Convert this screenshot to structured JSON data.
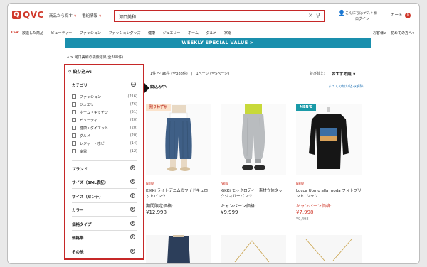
{
  "header": {
    "logo_text": "QVC",
    "nav": [
      {
        "label": "商品から探す",
        "chev": "∨"
      },
      {
        "label": "番組情報",
        "chev": "∨"
      }
    ],
    "search_value": "河口美和",
    "user_line1": "こんにちはゲスト様",
    "user_line2": "ログイン",
    "user_chev": "∨",
    "cart_label": "カート",
    "cart_count": "0"
  },
  "category_bar": {
    "tsv": "TSV",
    "items": [
      "放送した商品",
      "ビューティー",
      "ファッション",
      "ファッショングッズ",
      "健康",
      "ジュエリー",
      "ホーム",
      "グルメ",
      "家電"
    ],
    "favorites": "お客様",
    "favorites_chev": "∨",
    "first_time": "初めての方へ",
    "first_time_chev": "∨"
  },
  "banner": "WEEKLY SPECIAL VALUE >",
  "breadcrumb": {
    "text": "河口美和の検索結果(全388件)",
    "sep": ">"
  },
  "sidebar": {
    "title": "絞り込み:",
    "category_label": "カテゴリ",
    "category_items": [
      {
        "label": "ファッション",
        "count": "(216)"
      },
      {
        "label": "ジュエリー",
        "count": "(76)"
      },
      {
        "label": "ホーム・キッチン",
        "count": "(51)"
      },
      {
        "label": "ビューティ",
        "count": "(20)"
      },
      {
        "label": "健康・ダイエット",
        "count": "(20)"
      },
      {
        "label": "グルメ",
        "count": "(20)"
      },
      {
        "label": "レジャー・ホビー",
        "count": "(14)"
      },
      {
        "label": "家電",
        "count": "(12)"
      }
    ],
    "sections": [
      "ブランド",
      "サイズ（SML表記）",
      "サイズ（センチ）",
      "カラー",
      "価格タイプ",
      "価格帯",
      "その他"
    ],
    "minus": "−",
    "plus": "+"
  },
  "results": {
    "summary": "1件 ～ 96件 (全388件)　|　1ページ (全5ページ)",
    "sort_label": "並び替え:",
    "sort_value": "おすすめ順",
    "sort_chev": "∨",
    "filtering": "絞込み中:",
    "clear": "すべての絞り込み解除"
  },
  "products": [
    {
      "tag": "残りわずか",
      "new": "New",
      "name": "KiKKi ライトデニムのワイドキュロットパンツ",
      "price_label": "期間限定価格:",
      "price": "¥12,998",
      "old_price": ""
    },
    {
      "tag": "",
      "new": "New",
      "name": "KiKKi モックロディー素材立体タックジョガーパンツ",
      "price_label": "キャンペーン価格:",
      "price": "¥9,999",
      "old_price": ""
    },
    {
      "tag": "MEN'S",
      "new": "New",
      "name": "Lucca Uomo alla moda フォトプリントTシャツ",
      "price_label": "キャンペーン価格:",
      "price": "¥7,998",
      "old_price": "¥9,498"
    }
  ],
  "colors": {
    "brand_red": "#d0392b",
    "highlight_red": "#c62828",
    "banner_teal": "#1a8fad",
    "tag_orange_bg": "#fbe3cc",
    "tag_teal_bg": "#1a9aa8"
  },
  "icons": {
    "clear": "×",
    "search": "⚲",
    "home": "⌂",
    "cart": "🛒",
    "user": "👤"
  }
}
